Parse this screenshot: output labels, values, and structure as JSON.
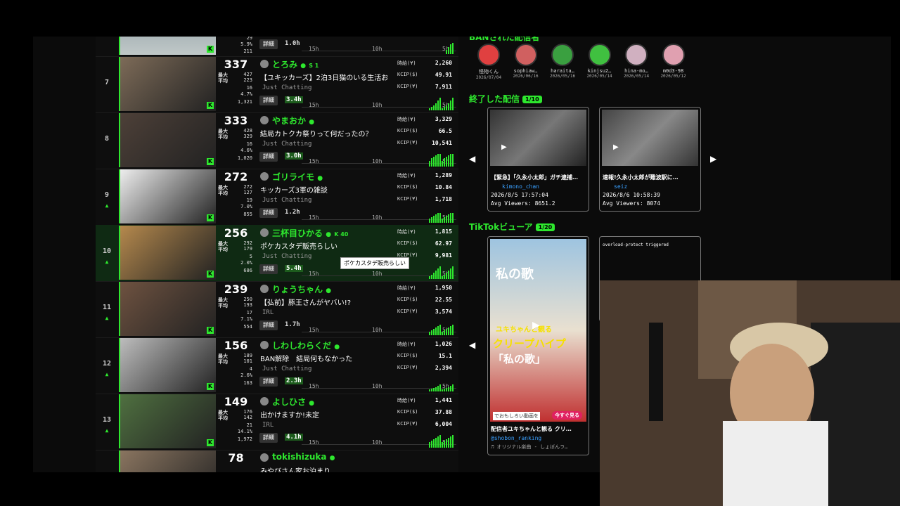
{
  "ranking": {
    "labels": {
      "max": "最大",
      "avg": "平均",
      "detail": "詳細",
      "t15": "15h",
      "t10": "10h",
      "t5": "5h",
      "hourly": "時給(¥)",
      "kcip_usd": "KCIP($)",
      "kcip_yen": "KCIP(¥)"
    },
    "top_partial": {
      "pct": "5.9%",
      "chat": "211",
      "duration": "1.0h",
      "s2": "29"
    },
    "rows": [
      {
        "rank": "7",
        "viewers": "337",
        "max": "427",
        "avg": "223",
        "s3": "16",
        "pct": "4.7%",
        "chat": "1,321",
        "name": "とろみ",
        "extra": "S 1",
        "title": "【ユキッカーズ】2泊3日猫のいる生活お",
        "category": "Just Chatting",
        "duration": "3.4h",
        "hourly": "2,260",
        "kcip_usd": "49.91",
        "kcip_yen": "7,911"
      },
      {
        "rank": "8",
        "viewers": "333",
        "max": "428",
        "avg": "329",
        "s3": "16",
        "pct": "4.6%",
        "chat": "1,020",
        "name": "やまおか",
        "extra": "",
        "title": "結局カトクカ祭りって何だったの？",
        "category": "Just Chatting",
        "duration": "3.0h",
        "hourly": "3,329",
        "kcip_usd": "66.5",
        "kcip_yen": "10,541"
      },
      {
        "rank": "9",
        "viewers": "272",
        "max": "272",
        "avg": "127",
        "s3": "19",
        "pct": "7.0%",
        "chat": "855",
        "name": "ゴリライモ",
        "extra": "",
        "title": "キッカーズ3軍の雑談",
        "category": "Just Chatting",
        "duration": "1.2h",
        "hourly": "1,289",
        "kcip_usd": "10.84",
        "kcip_yen": "1,718"
      },
      {
        "rank": "10",
        "viewers": "256",
        "max": "292",
        "avg": "179",
        "s3": "5",
        "pct": "2.0%",
        "chat": "686",
        "name": "三杯目ひかる",
        "extra": "K 40",
        "title": "ポケカスタデ販売らしい",
        "category": "Just Chatting",
        "duration": "5.4h",
        "hourly": "1,815",
        "kcip_usd": "62.97",
        "kcip_yen": "9,981"
      },
      {
        "rank": "11",
        "viewers": "239",
        "max": "250",
        "avg": "193",
        "s3": "17",
        "pct": "7.1%",
        "chat": "554",
        "name": "りょうちゃん",
        "extra": "",
        "title": "【弘前】豚王さんがヤバい!?",
        "category": "IRL",
        "duration": "1.7h",
        "hourly": "1,950",
        "kcip_usd": "22.55",
        "kcip_yen": "3,574"
      },
      {
        "rank": "12",
        "viewers": "156",
        "max": "189",
        "avg": "101",
        "s3": "4",
        "pct": "2.6%",
        "chat": "163",
        "name": "しわしわらくだ",
        "extra": "",
        "title": "BAN解除　結局何もなかった",
        "category": "Just Chatting",
        "duration": "2.3h",
        "hourly": "1,026",
        "kcip_usd": "15.1",
        "kcip_yen": "2,394"
      },
      {
        "rank": "13",
        "viewers": "149",
        "max": "176",
        "avg": "142",
        "s3": "21",
        "pct": "14.1%",
        "chat": "1,972",
        "name": "よしひさ",
        "extra": "",
        "title": "出かけますか!未定",
        "category": "IRL",
        "duration": "4.1h",
        "hourly": "1,441",
        "kcip_usd": "37.88",
        "kcip_yen": "6,004"
      },
      {
        "rank": "",
        "viewers": "78",
        "name": "tokishizuka",
        "title": "みやびさん家お泊まり"
      }
    ],
    "tooltip": "ポケカスタデ販売らしい"
  },
  "ban_section": {
    "title": "BANされた配信者",
    "items": [
      {
        "name": "怪物くん",
        "date": "2026/07/04",
        "color": "#e04040"
      },
      {
        "name": "sophiaw…",
        "date": "2026/06/16",
        "color": "#d06060"
      },
      {
        "name": "haraita…",
        "date": "2026/05/16",
        "color": "#3aa040"
      },
      {
        "name": "kinjsu2…",
        "date": "2026/05/14",
        "color": "#40c040"
      },
      {
        "name": "hina-mo…",
        "date": "2026/05/14",
        "color": "#d0b0c0"
      },
      {
        "name": "m0d3-98",
        "date": "2026/05/12",
        "color": "#e0a0b0"
      }
    ]
  },
  "ended_section": {
    "title": "終了した配信",
    "badge": "1/10",
    "cards": [
      {
        "title": "【緊急】「久永小太郎」ガチ逮捕…",
        "user": "kimono_chan",
        "date": "2026/8/5 17:57:04",
        "viewers": "Avg Viewers: 8651.2"
      },
      {
        "title": "速報!久永小太郎が難波駅に…",
        "user": "seiz",
        "date": "2026/8/6 10:58:39",
        "viewers": "Avg Viewers: 8074"
      }
    ]
  },
  "tiktok_section": {
    "title": "TikTokビューア",
    "badge": "1/20",
    "card": {
      "overlay_title": "私の歌",
      "caption": "ユキちゃんと観る",
      "big_text": "クリープハイプ",
      "quote": "「私の歌」",
      "footer": "でおもしろい動画を",
      "btn": "今すぐ見る",
      "title": "配信者ユキちゃんと観る クリ…",
      "user": "@shobon_ranking",
      "music": "♬ オリジナル楽曲 - しょぼんラ…"
    },
    "error_text": "overload-protect triggered"
  },
  "colors": {
    "accent": "#2ee82e",
    "bg": "#0b0b0b"
  }
}
